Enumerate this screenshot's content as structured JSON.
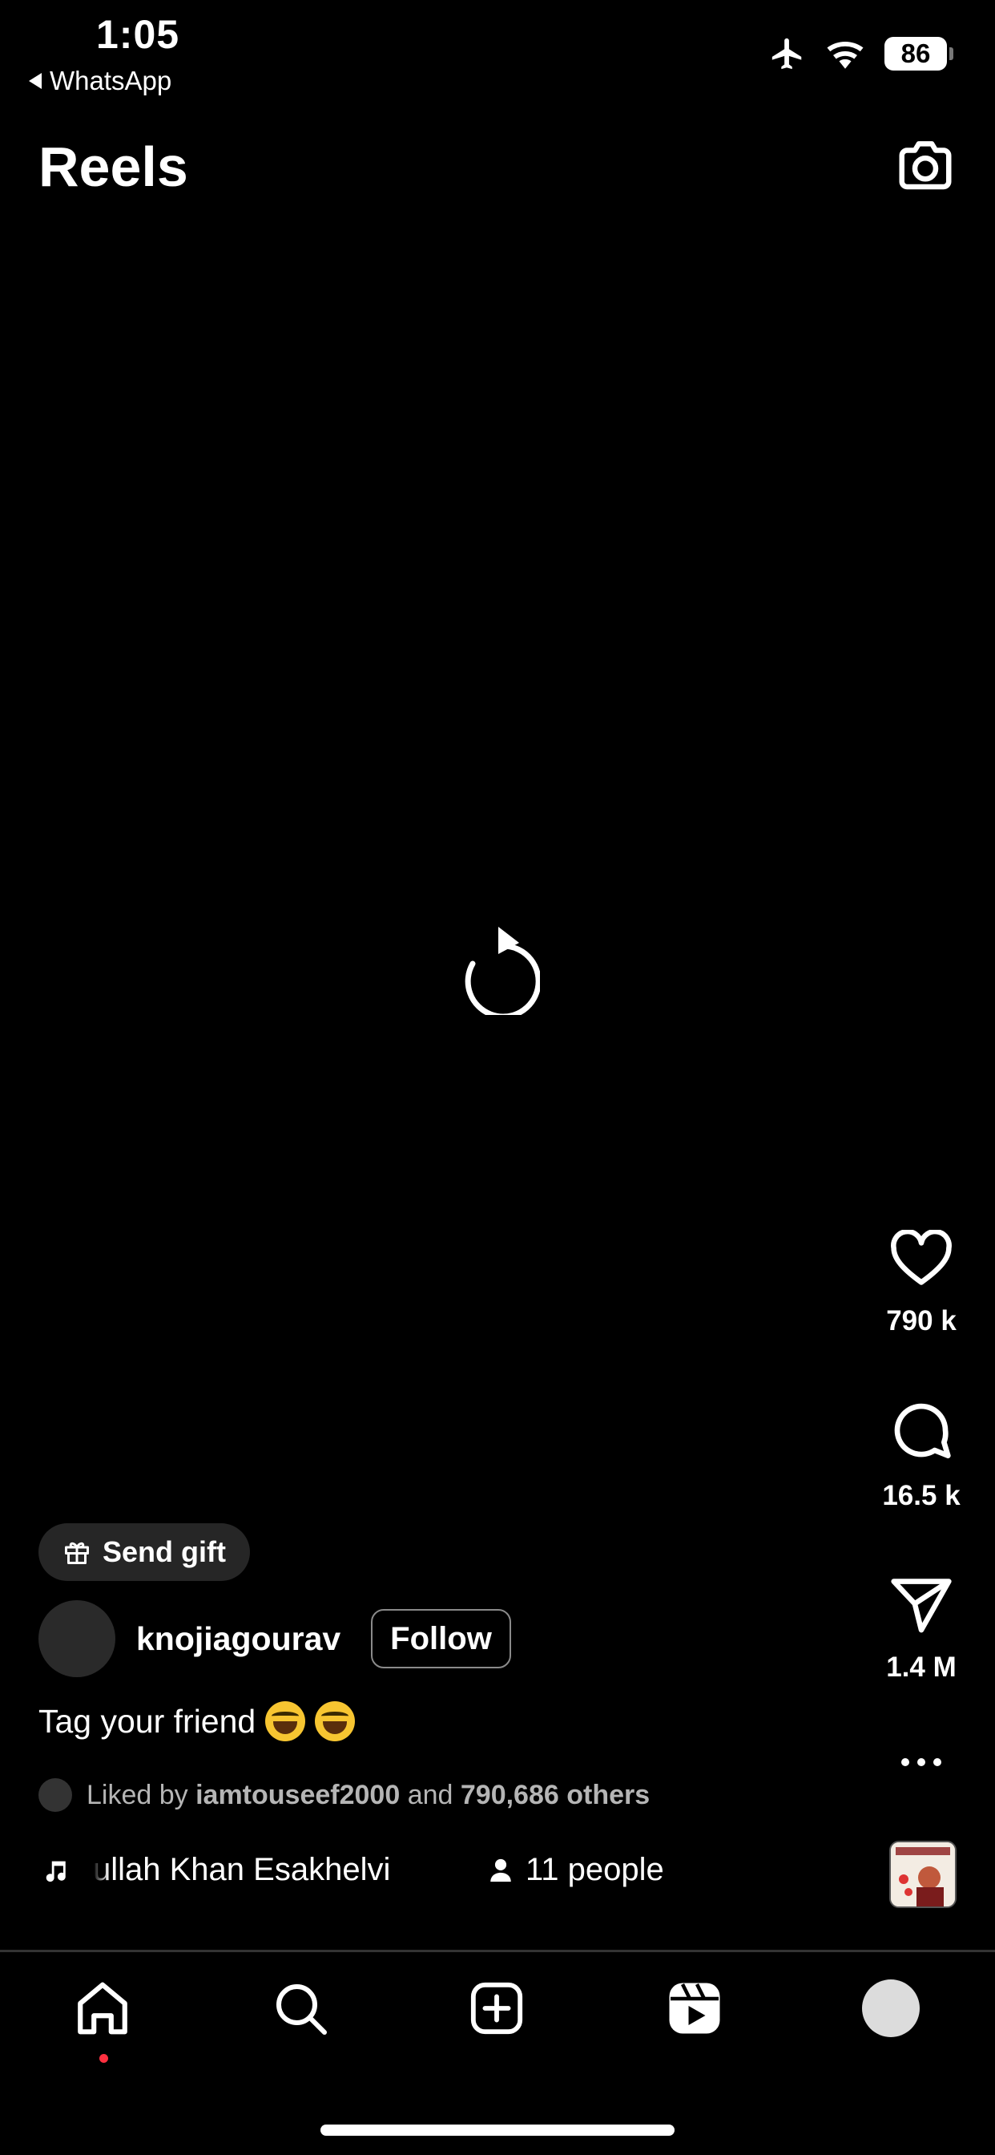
{
  "status_bar": {
    "time": "1:05",
    "back_app": "WhatsApp",
    "battery": "86",
    "icons": [
      "airplane-icon",
      "wifi-icon",
      "battery-icon"
    ]
  },
  "header": {
    "title": "Reels",
    "camera_icon": "camera-icon"
  },
  "player": {
    "reload_icon": "reload-icon"
  },
  "actions": {
    "likes": "790 k",
    "comments": "16.5 k",
    "shares": "1.4 M",
    "more_icon": "more-icon"
  },
  "post": {
    "send_gift_label": "Send gift",
    "username": "knojiagourav",
    "follow_label": "Follow",
    "caption": "Tag your friend",
    "caption_emojis": [
      "😂",
      "😂"
    ],
    "liked_by_prefix": "Liked by",
    "liked_by_user": "iamtouseef2000",
    "liked_by_and": "and",
    "liked_by_others": "790,686 others",
    "music_text": "ullah Khan Esakhelvi",
    "people_label": "11 people"
  },
  "nav": {
    "items": [
      "home",
      "search",
      "create",
      "reels",
      "profile"
    ]
  },
  "colors": {
    "background": "#000000",
    "text": "#ffffff",
    "notification_dot": "#ff3040",
    "pill_bg": "#262626"
  }
}
